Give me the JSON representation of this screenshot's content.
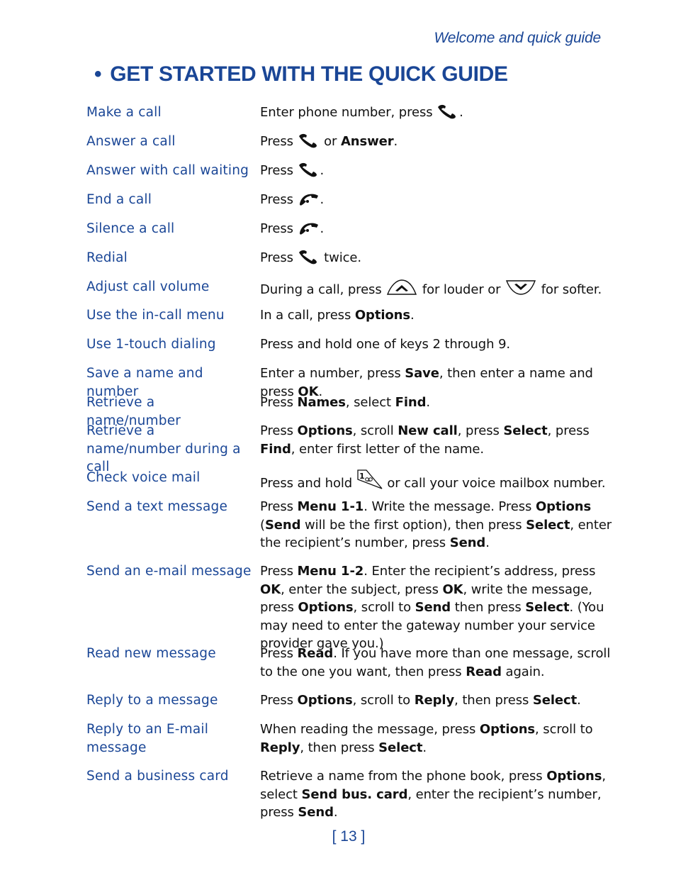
{
  "header": {
    "running_head": "Welcome and quick guide",
    "title_bullet": "•",
    "title": "GET STARTED WITH THE QUICK GUIDE"
  },
  "colors": {
    "accent": "#1a4696",
    "body_text": "#111111"
  },
  "icons": {
    "send_key": "phone-send-icon",
    "end_key": "phone-end-icon",
    "scroll_up": "scroll-up-key-icon",
    "scroll_down": "scroll-down-key-icon",
    "voicemail_key": "key-1-voicemail-icon"
  },
  "rows": [
    {
      "task": "Make a call",
      "segs": [
        {
          "t": "Enter phone number, press "
        },
        {
          "icon": "send"
        },
        {
          "t": "."
        }
      ]
    },
    {
      "task": "Answer a call",
      "segs": [
        {
          "t": "Press "
        },
        {
          "icon": "send"
        },
        {
          "t": " or "
        },
        {
          "b": "Answer"
        },
        {
          "t": "."
        }
      ]
    },
    {
      "task": "Answer with call waiting",
      "segs": [
        {
          "t": "Press "
        },
        {
          "icon": "send"
        },
        {
          "t": "."
        }
      ]
    },
    {
      "task": "End a call",
      "segs": [
        {
          "t": "Press "
        },
        {
          "icon": "end"
        },
        {
          "t": "."
        }
      ]
    },
    {
      "task": "Silence a call",
      "segs": [
        {
          "t": "Press "
        },
        {
          "icon": "end"
        },
        {
          "t": "."
        }
      ]
    },
    {
      "task": "Redial",
      "segs": [
        {
          "t": "Press "
        },
        {
          "icon": "send"
        },
        {
          "t": " twice."
        }
      ]
    },
    {
      "task": "Adjust call volume",
      "segs": [
        {
          "t": "During a call, press "
        },
        {
          "icon": "up"
        },
        {
          "t": " for louder or "
        },
        {
          "icon": "down"
        },
        {
          "t": " for softer."
        }
      ]
    },
    {
      "task": "Use the in-call menu",
      "segs": [
        {
          "t": "In a call, press "
        },
        {
          "b": "Options"
        },
        {
          "t": "."
        }
      ]
    },
    {
      "task": "Use 1-touch dialing",
      "segs": [
        {
          "t": "Press and hold one of keys 2 through 9."
        }
      ]
    },
    {
      "task": "Save a name and number",
      "segs": [
        {
          "t": "Enter a number, press "
        },
        {
          "b": "Save"
        },
        {
          "t": ", then enter a name and press "
        },
        {
          "b": "OK"
        },
        {
          "t": "."
        }
      ]
    },
    {
      "task": "Retrieve a name/number",
      "segs": [
        {
          "t": "Press "
        },
        {
          "b": "Names"
        },
        {
          "t": ", select "
        },
        {
          "b": "Find"
        },
        {
          "t": "."
        }
      ]
    },
    {
      "task": "Retrieve a name/number during a call",
      "segs": [
        {
          "t": "Press "
        },
        {
          "b": "Options"
        },
        {
          "t": ", scroll "
        },
        {
          "b": "New call"
        },
        {
          "t": ", press "
        },
        {
          "b": "Select"
        },
        {
          "t": ", press "
        },
        {
          "b": "Find"
        },
        {
          "t": ", enter first letter of the name."
        }
      ]
    },
    {
      "task": "Check voice mail",
      "segs": [
        {
          "t": "Press and hold "
        },
        {
          "icon": "vm"
        },
        {
          "t": " or call your voice mailbox number."
        }
      ]
    },
    {
      "task": "Send a text message",
      "segs": [
        {
          "t": "Press "
        },
        {
          "b": "Menu 1-1"
        },
        {
          "t": ". Write the message. Press "
        },
        {
          "b": "Options"
        },
        {
          "t": " ("
        },
        {
          "b": "Send"
        },
        {
          "t": " will be the first option), then press "
        },
        {
          "b": "Select"
        },
        {
          "t": ", enter the recipient’s number, press "
        },
        {
          "b": "Send"
        },
        {
          "t": "."
        }
      ]
    },
    {
      "task": "Send an e-mail message",
      "segs": [
        {
          "t": "Press "
        },
        {
          "b": "Menu 1-2"
        },
        {
          "t": ". Enter the recipient’s address, press "
        },
        {
          "b": "OK"
        },
        {
          "t": ", enter the subject, press "
        },
        {
          "b": "OK"
        },
        {
          "t": ", write the message, press "
        },
        {
          "b": "Options"
        },
        {
          "t": ", scroll to "
        },
        {
          "b": "Send"
        },
        {
          "t": " then press "
        },
        {
          "b": "Select"
        },
        {
          "t": ". (You may need to enter the gateway number your service provider gave you.)"
        }
      ]
    },
    {
      "task": "Read new message",
      "segs": [
        {
          "t": "Press "
        },
        {
          "b": "Read"
        },
        {
          "t": ". If you have more than one message, scroll to the one you want, then press "
        },
        {
          "b": "Read"
        },
        {
          "t": " again."
        }
      ]
    },
    {
      "task": "Reply to a message",
      "segs": [
        {
          "t": "Press "
        },
        {
          "b": "Options"
        },
        {
          "t": ", scroll to "
        },
        {
          "b": "Reply"
        },
        {
          "t": ", then press "
        },
        {
          "b": "Select"
        },
        {
          "t": "."
        }
      ]
    },
    {
      "task": "Reply to an E-mail message",
      "segs": [
        {
          "t": "When reading the message, press "
        },
        {
          "b": "Options"
        },
        {
          "t": ", scroll to "
        },
        {
          "b": "Reply"
        },
        {
          "t": ", then press "
        },
        {
          "b": "Select"
        },
        {
          "t": "."
        }
      ]
    },
    {
      "task": "Send a business card",
      "segs": [
        {
          "t": "Retrieve a name from the phone book, press "
        },
        {
          "b": "Options"
        },
        {
          "t": ", select "
        },
        {
          "b": "Send bus. card"
        },
        {
          "t": ", enter the recipient’s number, press "
        },
        {
          "b": "Send"
        },
        {
          "t": "."
        }
      ]
    }
  ],
  "footer": {
    "page_number": "[ 13 ]"
  }
}
